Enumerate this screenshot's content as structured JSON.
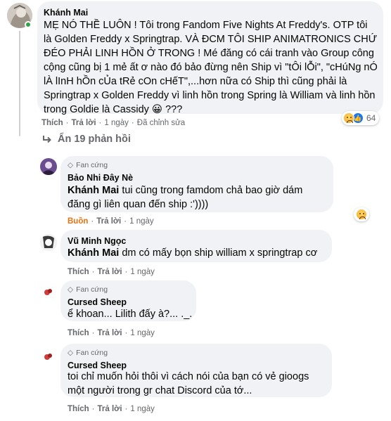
{
  "main_comment": {
    "author": "Khánh Mai",
    "text": "MẸ NÓ THỀ LUÔN ! Tôi trong Fandom Five Nights At Freddy's. OTP tôi là Golden Freddy x Springtrap. VÀ ĐCM TÔI SHIP ANIMATRONICS CHỨ ĐÉO PHẢI LINH HỒN Ở TRONG ! Mé đăng có cái tranh vào Group công cộng cũng bị 1 mẻ ất ơ nào đó bảo đừng nên Ship vì \"tÔi lỖi\", \"cHúNg nÓ lÀ lInH hỒn cỦa tRẻ cOn cHếT\",...hơn nữa có Ship thì cũng phải là Springtrap x Golden Freddy vì linh hồn trong Spring là William và linh hồn trong Goldie là Cassidy 😀 ???",
    "like_label": "Thích",
    "reply_label": "Trả lời",
    "time": "1 ngày",
    "edited": "Đã chỉnh sửa",
    "reaction_count": "64"
  },
  "replies_toggle": {
    "label": "Ẩn 19 phản hồi",
    "icon": "reply-arrow-icon"
  },
  "replies": [
    {
      "badge": "Fan cứng",
      "author": "Bảo Nhi Đây Nè",
      "mention": "Khánh Mai",
      "text": " tui cũng trong famdom chả bao giờ dám đăng gì liên quan đến ship :'))))",
      "reaction_label": "Buồn",
      "reply_label": "Trả lời",
      "time": "1 ngày"
    },
    {
      "author": "Vũ Minh Ngọc",
      "mention": "Khánh Mai",
      "text": " dm có mấy bọn ship william x springtrap cơ",
      "like_label": "Thích",
      "reply_label": "Trả lời",
      "time": "1 ngày"
    },
    {
      "badge": "Fan cứng",
      "author": "Cursed Sheep",
      "text": "ể khoan... Lilith đấy à?... ._.",
      "like_label": "Thích",
      "reply_label": "Trả lời",
      "time": "1 ngày"
    },
    {
      "badge": "Fan cứng",
      "author": "Cursed Sheep",
      "text": "toi chỉ muốn hỏi thôi vì cách nói của bạn có vẻ gioogs một người trong gr chat Discord của tớ...",
      "like_label": "Thích",
      "reply_label": "Trả lời",
      "time": "1 ngày"
    }
  ],
  "colors": {
    "bubble": "#f0f2f5",
    "secondary_text": "#65676b",
    "sad_reaction": "#e9710f",
    "online": "#31a24c"
  }
}
